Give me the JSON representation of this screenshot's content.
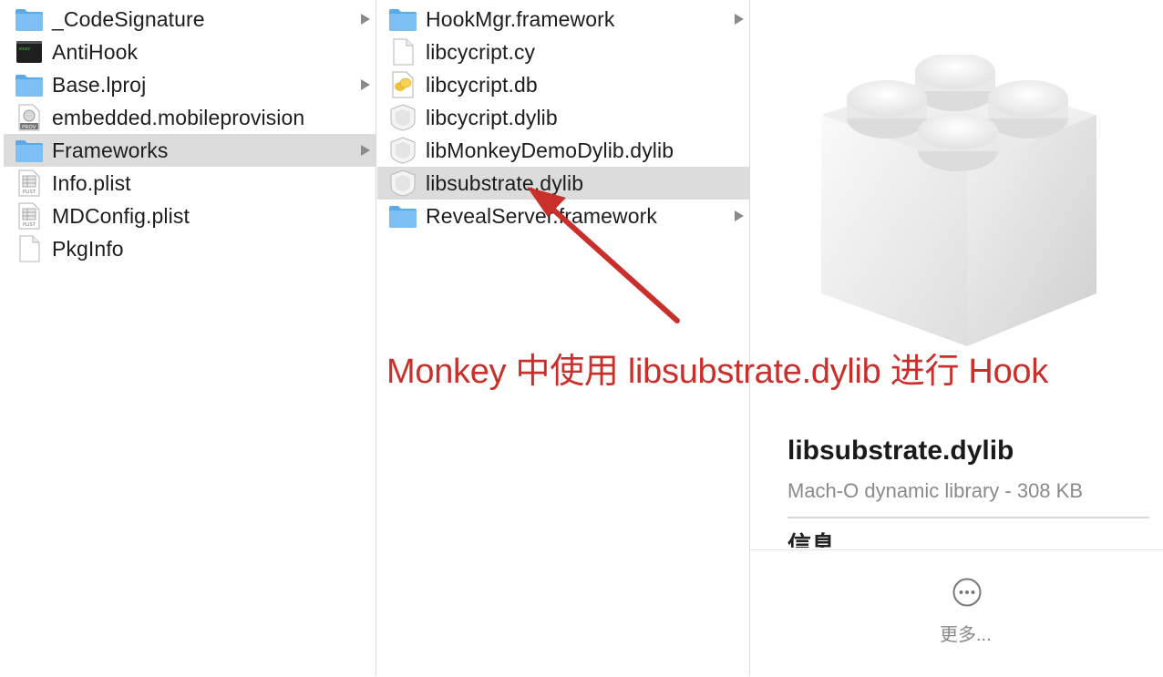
{
  "column1": {
    "items": [
      {
        "label": "_CodeSignature",
        "icon": "folder-icon",
        "chevron": true,
        "selected": false
      },
      {
        "label": "AntiHook",
        "icon": "terminal-executable-icon",
        "chevron": false,
        "selected": false
      },
      {
        "label": "Base.lproj",
        "icon": "folder-icon",
        "chevron": true,
        "selected": false
      },
      {
        "label": "embedded.mobileprovision",
        "icon": "provision-file-icon",
        "chevron": false,
        "selected": false
      },
      {
        "label": "Frameworks",
        "icon": "folder-icon",
        "chevron": true,
        "selected": true
      },
      {
        "label": "Info.plist",
        "icon": "plist-file-icon",
        "chevron": false,
        "selected": false
      },
      {
        "label": "MDConfig.plist",
        "icon": "plist-file-icon",
        "chevron": false,
        "selected": false
      },
      {
        "label": "PkgInfo",
        "icon": "blank-document-icon",
        "chevron": false,
        "selected": false
      }
    ]
  },
  "column2": {
    "items": [
      {
        "label": "HookMgr.framework",
        "icon": "folder-icon",
        "chevron": true,
        "selected": false
      },
      {
        "label": "libcycript.cy",
        "icon": "blank-document-icon",
        "chevron": false,
        "selected": false
      },
      {
        "label": "libcycript.db",
        "icon": "database-file-icon",
        "chevron": false,
        "selected": false
      },
      {
        "label": "libcycript.dylib",
        "icon": "dylib-file-icon",
        "chevron": false,
        "selected": false
      },
      {
        "label": "libMonkeyDemoDylib.dylib",
        "icon": "dylib-file-icon",
        "chevron": false,
        "selected": false
      },
      {
        "label": "libsubstrate.dylib",
        "icon": "dylib-file-icon",
        "chevron": false,
        "selected": true
      },
      {
        "label": "RevealServer.framework",
        "icon": "folder-icon",
        "chevron": true,
        "selected": false
      }
    ]
  },
  "preview": {
    "icon": "lego-brick-library-icon",
    "title": "libsubstrate.dylib",
    "subtitle": "Mach-O dynamic library - 308 KB",
    "info_heading": "信息",
    "more_label": "更多..."
  },
  "annotation": {
    "text": "Monkey 中使用 libsubstrate.dylib 进行 Hook",
    "color": "#c9302c"
  },
  "colors": {
    "selection": "#dcdcdc",
    "folder": "#6cb6ef",
    "annotation": "#c9302c"
  }
}
